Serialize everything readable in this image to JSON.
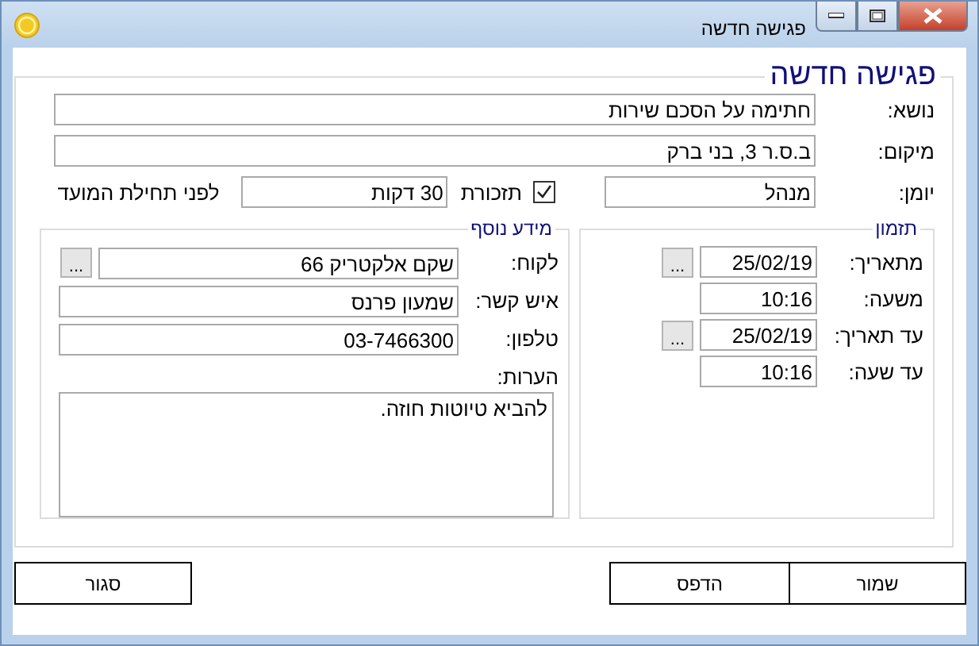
{
  "window": {
    "title": "פגישה חדשה"
  },
  "form": {
    "title": "פגישה חדשה",
    "fields": [
      {
        "label": "נושא:",
        "value": "חתימה על הסכם שירות"
      },
      {
        "label": "מיקום:",
        "value": "ב.ס.ר 3, בני ברק"
      }
    ],
    "calendar": {
      "label": "יומן:",
      "value": "מנהל"
    },
    "reminder": {
      "label": "תזכורת",
      "checked": true,
      "value": "30 דקות",
      "suffix": "לפני תחילת המועד"
    },
    "timing": {
      "title": "תזמון",
      "rows": [
        {
          "label": "מתאריך:",
          "value": "25/02/19",
          "button": "..."
        },
        {
          "label": "משעה:",
          "value": "10:16"
        },
        {
          "label": "עד תאריך:",
          "value": "25/02/19",
          "button": "..."
        },
        {
          "label": "עד שעה:",
          "value": "10:16"
        }
      ]
    },
    "extra": {
      "title": "מידע נוסף",
      "rows": [
        {
          "label": "לקוח:",
          "value": "שקם אלקטריק  66",
          "button": "..."
        },
        {
          "label": "איש קשר:",
          "value": "שמעון פרנס"
        },
        {
          "label": "טלפון:",
          "value": "03-7466300"
        }
      ],
      "notes": {
        "label": "הערות:",
        "value": "להביא טיוטות חוזה."
      }
    }
  },
  "actions": [
    "שמור",
    "הדפס"
  ],
  "close": "סגור"
}
